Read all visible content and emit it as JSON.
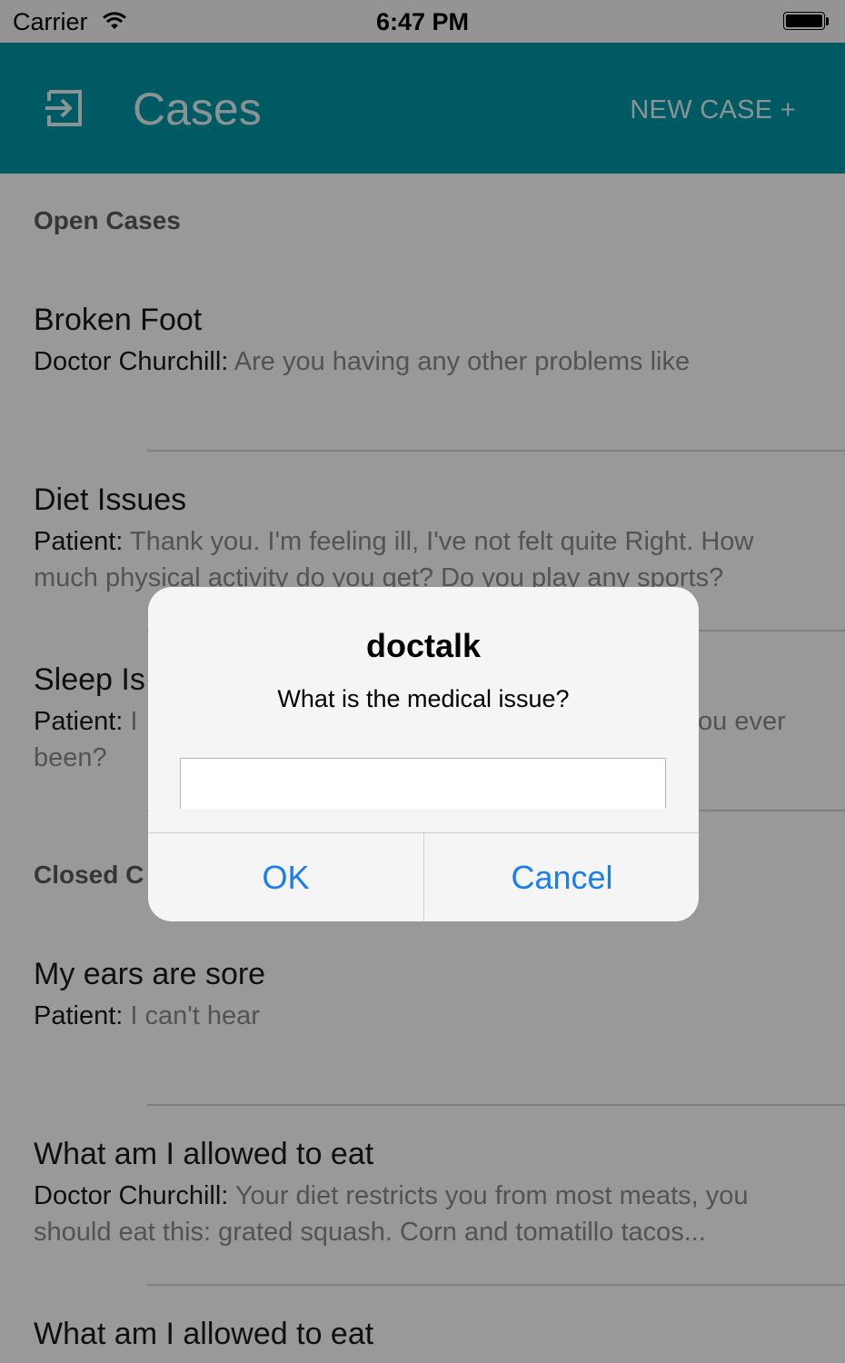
{
  "status_bar": {
    "carrier": "Carrier",
    "time": "6:47 PM"
  },
  "app_bar": {
    "title": "Cases",
    "new_case_label": "NEW CASE +",
    "exit_icon": "exit-icon"
  },
  "open_section": {
    "label": "Open Cases",
    "items": [
      {
        "title": "Broken Foot",
        "sender": "Doctor Churchill:",
        "text": " Are you having any other problems like"
      },
      {
        "title": "Diet Issues",
        "sender": "Patient:",
        "text": " Thank you. I'm feeling ill, I've not felt quite Right. How much physical activity do you get? Do you play any sports?"
      },
      {
        "title": "Sleep Is",
        "sender": "Patient:",
        "text": " I",
        "text_tail": "ou ever",
        "text_line2": "been?"
      }
    ]
  },
  "closed_section": {
    "label": "Closed C",
    "items": [
      {
        "title": "My ears are sore",
        "sender": "Patient:",
        "text": " I can't hear"
      },
      {
        "title": "What am I allowed to eat",
        "sender": "Doctor Churchill:",
        "text": " Your diet restricts you from most meats, you should eat this: grated squash. Corn and tomatillo tacos..."
      },
      {
        "title": "What am I allowed to eat"
      }
    ]
  },
  "alert": {
    "title": "doctalk",
    "message": "What is the medical issue?",
    "input_value": "",
    "ok_label": "OK",
    "cancel_label": "Cancel"
  }
}
